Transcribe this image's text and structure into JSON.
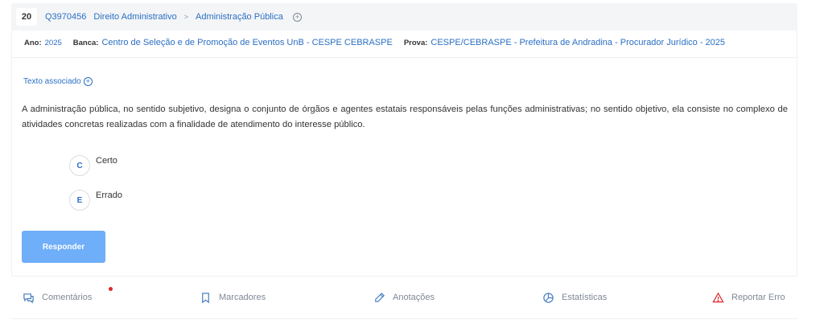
{
  "header": {
    "number": "20",
    "question_id": "Q3970456",
    "breadcrumbs": [
      "Direito Administrativo",
      "Administração Pública"
    ],
    "separator": ">"
  },
  "meta": {
    "ano_label": "Ano:",
    "ano_value": "2025",
    "banca_label": "Banca:",
    "banca_value": "Centro de Seleção e de Promoção de Eventos UnB - CESPE CEBRASPE",
    "prova_label": "Prova:",
    "prova_value": "CESPE/CEBRASPE - Prefeitura de Andradina - Procurador Jurídico - 2025"
  },
  "associated_text_label": "Texto associado",
  "statement": "A administração pública, no sentido subjetivo, designa o conjunto de órgãos e agentes estatais responsáveis pelas funções administrativas; no sentido objetivo, ela consiste no complexo de atividades concretas realizadas com a finalidade de atendimento do interesse público.",
  "alternatives": [
    {
      "letter": "C",
      "text": "Certo"
    },
    {
      "letter": "E",
      "text": "Errado"
    }
  ],
  "answer_button": "Responder",
  "toolbar": {
    "comments": "Comentários",
    "bookmarks": "Marcadores",
    "notes": "Anotações",
    "stats": "Estatísticas",
    "report": "Reportar Erro"
  },
  "colors": {
    "link": "#2b6fc4",
    "button": "#6faef8",
    "muted": "#7f8896",
    "notification_dot": "#e0262b",
    "report_icon": "#e0262b"
  },
  "icons": [
    "plus-circle-icon",
    "comment-icon",
    "bookmark-icon",
    "pencil-icon",
    "pie-chart-icon",
    "warning-icon"
  ]
}
